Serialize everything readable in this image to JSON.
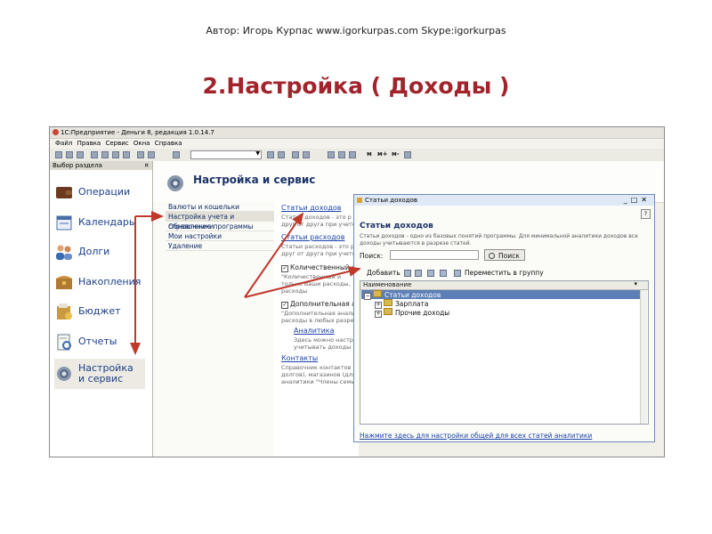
{
  "slide": {
    "author": "Автор: Игорь Курпас www.igorkurpas.com  Skype:igorkurpas",
    "title": "2.Настройка ( Доходы )"
  },
  "app": {
    "window_title": "1С:Предприятие - Деньги 8, редакция 1.0.14.7",
    "menu": [
      "Файл",
      "Правка",
      "Сервис",
      "Окна",
      "Справка"
    ],
    "toolbar_text": [
      "м",
      "м+",
      "м-"
    ]
  },
  "sidebar": {
    "header": "Выбор раздела",
    "items": [
      {
        "label": "Операции",
        "icon": "wallet-icon"
      },
      {
        "label": "Календарь",
        "icon": "calendar-icon"
      },
      {
        "label": "Долги",
        "icon": "people-icon"
      },
      {
        "label": "Накопления",
        "icon": "chest-icon"
      },
      {
        "label": "Бюджет",
        "icon": "budget-icon"
      },
      {
        "label": "Отчеты",
        "icon": "report-icon"
      },
      {
        "label": "Настройка и сервис",
        "icon": "gear-icon",
        "active": true
      }
    ]
  },
  "content": {
    "title": "Настройка и сервис",
    "menu": [
      {
        "label": "Валюты и кошельки"
      },
      {
        "label": "Настройка учета и справочники",
        "selected": true
      },
      {
        "label": "Обновление программы"
      },
      {
        "label": "Мои настройки"
      },
      {
        "label": "Удаление"
      }
    ],
    "links": {
      "income": "Статьи доходов",
      "income_desc": "Статьи доходов - это р",
      "income_desc2": "друг от друга при учете",
      "expense": "Статьи расходов",
      "expense_desc": "Статьи расходов - это р",
      "expense_desc2": "друг от друга при учете",
      "quant": "Количественный и",
      "quant_desc1": "\"Количественный и",
      "quant_desc2": "только Ваши расходы,",
      "quant_desc3": "расходы",
      "additional": "Дополнительная анал",
      "additional_desc1": "\"Дополнительная аналит",
      "additional_desc2": "расходы в любых разрез",
      "analytics": "Аналитика",
      "analytics_desc1": "Здесь можно настрои",
      "analytics_desc2": "учитывать доходы и",
      "contacts": "Контакты",
      "contacts_desc1": "Справочник контактов с",
      "contacts_desc2": "долгов), магазинов (для",
      "contacts_desc3": "аналитики \"Члены семьи"
    }
  },
  "dialog": {
    "title": "Статьи доходов",
    "heading": "Статьи доходов",
    "description": "Статьи доходов - одно из базовых понятий программы. Для минимальной аналитики доходов все доходы учитываются в разрезе статей.",
    "search_label": "Поиск:",
    "search_value": "",
    "search_button": "Поиск",
    "add_button": "Добавить",
    "move_button": "Переместить в группу",
    "column_header": "Наименование",
    "rows": [
      {
        "label": "Статьи доходов",
        "selected": true
      },
      {
        "label": "Зарплата"
      },
      {
        "label": "Прочие доходы"
      }
    ],
    "footer_link": "Нажмите здесь для настройки общей для всех статей аналитики"
  },
  "colors": {
    "title_red": "#a1232b",
    "link_blue": "#1c43a8",
    "arrow_red": "#c0392b",
    "selection_blue": "#5b7fb6"
  }
}
